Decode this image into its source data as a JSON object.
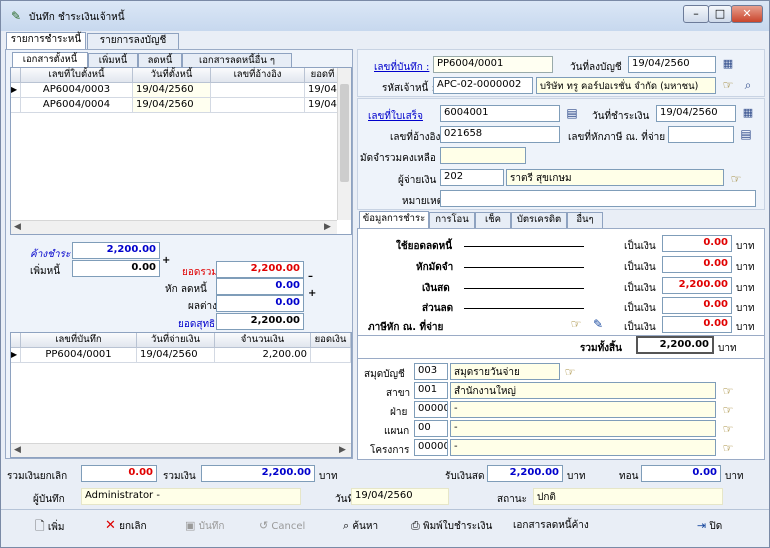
{
  "window": {
    "title": "บันทึก ชำระเงินเจ้าหนี้",
    "min": "–",
    "max": "□",
    "close": "✕"
  },
  "top_tabs": [
    "รายการชำระหนี้",
    "รายการลงบัญชี"
  ],
  "sub_tabs": [
    "เอกสารตั้งหนี้",
    "เพิ่มหนี้",
    "ลดหนี้",
    "เอกสารลดหนี้อื่น ๆ"
  ],
  "debt_grid": {
    "headers": [
      "เลขที่ใบตั้งหนี้",
      "วันที่ตั้งหนี้",
      "เลขที่อ้างอิง",
      "ยอดที่อ้างอิง"
    ],
    "rows": [
      [
        "AP6004/0003",
        "19/04/2560",
        "",
        "19/04/"
      ],
      [
        "AP6004/0004",
        "19/04/2560",
        "",
        "19/04/"
      ]
    ]
  },
  "left_summary": {
    "owed_label": "ค้างชำระ",
    "owed": "2,200.00",
    "add_label": "เพิ่มหนี้",
    "add": "0.00",
    "plus": "+",
    "total_label": "ยอดรวม",
    "total": "2,200.00",
    "minus": "–",
    "deduct_label": "หัก ลดหนี้",
    "deduct": "0.00",
    "diff_label": "ผลต่าง",
    "diff": "0.00",
    "net_label": "ยอดสุทธิ",
    "net": "2,200.00"
  },
  "record_grid": {
    "headers": [
      "เลขที่บันทึก",
      "วันที่จ่ายเงิน",
      "จำนวนเงิน",
      "ยอดเงิน"
    ],
    "rows": [
      [
        "PP6004/0001",
        "19/04/2560",
        "2,200.00",
        ""
      ]
    ]
  },
  "header_fields": {
    "record_no_label": "เลขที่บันทึก :",
    "record_no": "PP6004/0001",
    "post_date_label": "วันที่ลงบัญชี",
    "post_date": "19/04/2560",
    "creditor_label": "รหัสเจ้าหนี้ :",
    "creditor_code": "APC-02-0000002",
    "creditor_name": "บริษัท ทรู คอร์ปอเรชั่น จำกัด (มหาชน)"
  },
  "receipt": {
    "receipt_no_label": "เลขที่ใบเสร็จ",
    "receipt_no": "6004001",
    "pay_date_label": "วันที่ชำระเงิน",
    "pay_date": "19/04/2560",
    "ref_label": "เลขที่อ้างอิง",
    "ref": "021658",
    "wht_no_label": "เลขที่หักภาษี ณ. ที่จ่าย",
    "wht_no": "",
    "deposit_label": "มัดจำรวมคงเหลือ",
    "deposit": "",
    "payer_label": "ผู้จ่ายเงิน",
    "payer_code": "202",
    "payer_name": "ราตรี สุขเกษม",
    "note_label": "หมายเหตุ",
    "note": ""
  },
  "pay_tabs": [
    "ข้อมูลการชำระ",
    "การโอน",
    "เช็ค",
    "บัตรเครดิต",
    "อื่นๆ"
  ],
  "pay_lines": [
    {
      "label": "ใช้ยอดลดหนี้",
      "kind": "เป็นเงิน",
      "value": "0.00",
      "unit": "บาท"
    },
    {
      "label": "หักมัดจำ",
      "kind": "เป็นเงิน",
      "value": "0.00",
      "unit": "บาท"
    },
    {
      "label": "เงินสด",
      "kind": "เป็นเงิน",
      "value": "2,200.00",
      "unit": "บาท"
    },
    {
      "label": "ส่วนลด",
      "kind": "เป็นเงิน",
      "value": "0.00",
      "unit": "บาท"
    },
    {
      "label": "ภาษีหัก ณ. ที่จ่าย",
      "kind": "เป็นเงิน",
      "value": "0.00",
      "unit": "บาท"
    }
  ],
  "grand_total": {
    "label": "รวมทั้งสิ้น",
    "value": "2,200.00",
    "unit": "บาท"
  },
  "accounts": [
    {
      "label": "สมุดบัญชี",
      "code": "003",
      "name": "สมุดรายวันจ่าย"
    },
    {
      "label": "สาขา",
      "code": "001",
      "name": "สำนักงานใหญ่"
    },
    {
      "label": "ฝ่าย",
      "code": "00000",
      "name": "-"
    },
    {
      "label": "แผนก",
      "code": "00",
      "name": "-"
    },
    {
      "label": "โครงการ",
      "code": "00000",
      "name": "-"
    }
  ],
  "bottom": {
    "cancel_total_label": "รวมเงินยกเลิก",
    "cancel_total": "0.00",
    "sum_label": "รวมเงิน",
    "sum": "2,200.00",
    "sum_unit": "บาท",
    "cash_label": "รับเงินสด",
    "cash": "2,200.00",
    "cash_unit": "บาท",
    "change_label": "ทอน",
    "change": "0.00",
    "change_unit": "บาท",
    "recorder_label": "ผู้บันทึก",
    "recorder": "Administrator -",
    "date_label": "วันที่",
    "date": "19/04/2560",
    "status_label": "สถานะ",
    "status": "ปกติ"
  },
  "toolbar": {
    "add": "เพิ่ม",
    "cancel_doc": "ยกเลิก",
    "save": "บันทึก",
    "cancel": "Cancel",
    "search": "ค้นหา",
    "print": "พิมพ์ใบชำระเงิน",
    "pending": "เอกสารลดหนี้ค้าง",
    "close": "ปิด"
  }
}
